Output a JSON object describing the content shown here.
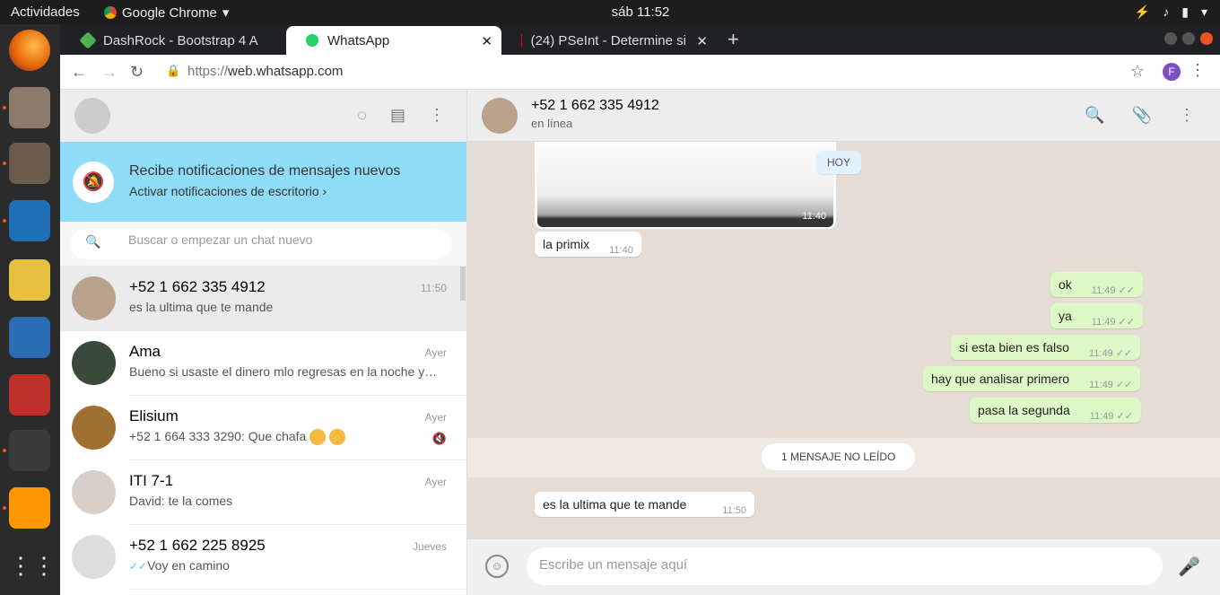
{
  "os": {
    "activities": "Actividades",
    "app_name": "Google Chrome",
    "clock": "sáb 11:52"
  },
  "browser": {
    "tabs": [
      {
        "title": "DashRock - Bootstrap 4 A",
        "color": "#4caf50"
      },
      {
        "title": "WhatsApp",
        "color": "#25d366"
      },
      {
        "title": "(24) PSeInt - Determine si",
        "color": "#ff0000"
      }
    ],
    "url_proto": "https://",
    "url_host": "web.whatsapp.com",
    "profile_initial": "F"
  },
  "left": {
    "notification": {
      "title": "Recibe notificaciones de mensajes nuevos",
      "subtitle": "Activar notificaciones de escritorio ›"
    },
    "search_placeholder": "Buscar o empezar un chat nuevo",
    "chats": [
      {
        "name": "+52 1 662 335 4912",
        "time": "11:50",
        "message": "es la ultima que te mande",
        "avatar_color": "#b9a38c"
      },
      {
        "name": "Ama",
        "time": "Ayer",
        "message": "Bueno si usaste el dinero mlo regresas en la noche y…",
        "avatar_color": "#3a4a3a"
      },
      {
        "name": "Elisium",
        "time": "Ayer",
        "message": "+52 1 664 333 3290: Que chafa",
        "avatar_color": "#a07030"
      },
      {
        "name": "ITI 7-1",
        "time": "Ayer",
        "message": "David: te la comes",
        "avatar_color": "#d8d0c8"
      },
      {
        "name": "+52 1 662 225 8925",
        "time": "Jueves",
        "message": "Voy en camino",
        "avatar_color": "#dddddd"
      }
    ]
  },
  "conversation": {
    "contact_name": "+52 1 662 335 4912",
    "contact_status": "en línea",
    "day_label": "HOY",
    "image_time": "11:40",
    "messages_in_top": [
      {
        "text": "la primix",
        "time": "11:40"
      }
    ],
    "messages_out": [
      {
        "text": "ok",
        "time": "11:49"
      },
      {
        "text": "ya",
        "time": "11:49"
      },
      {
        "text": "si esta bien es falso",
        "time": "11:49"
      },
      {
        "text": "hay que analisar primero",
        "time": "11:49"
      },
      {
        "text": "pasa la segunda",
        "time": "11:49"
      }
    ],
    "unread_label": "1 MENSAJE NO LEÍDO",
    "messages_in_bottom": [
      {
        "text": "es la ultima que te mande",
        "time": "11:50"
      }
    ],
    "compose_placeholder": "Escribe un mensaje aquí"
  }
}
